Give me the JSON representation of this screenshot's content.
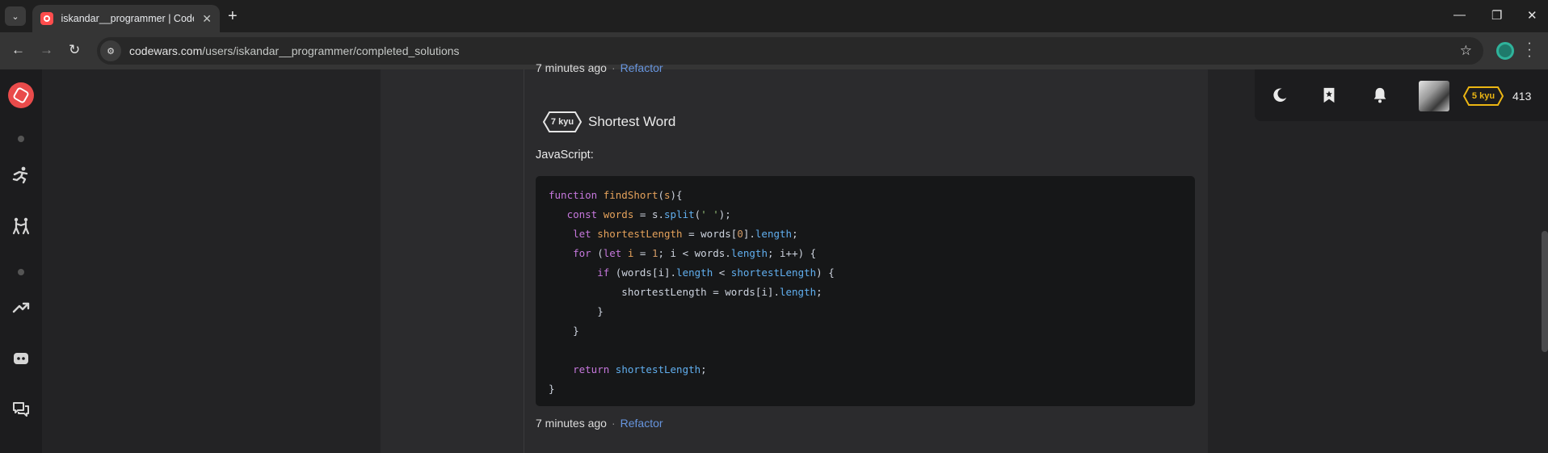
{
  "browser": {
    "tab_title": "iskandar__programmer | Codewars",
    "url_host": "codewars.com",
    "url_path": "/users/iskandar__programmer/completed_solutions",
    "new_tab": "+",
    "tab_close": "✕",
    "minimize": "—",
    "restore": "❐",
    "close": "✕",
    "back": "←",
    "forward": "→",
    "reload": "↻",
    "star": "☆",
    "site_info": "⚙",
    "tab_search": "⌄"
  },
  "topbar": {
    "kyu_badge": "5 kyu",
    "honor": "413"
  },
  "previous_solution": {
    "time": "7 minutes ago",
    "separator": "·",
    "refactor": "Refactor"
  },
  "solution": {
    "rank": "7 kyu",
    "title": "Shortest Word",
    "language": "JavaScript:",
    "time": "7 minutes ago",
    "separator": "·",
    "refactor": "Refactor",
    "code": [
      [
        {
          "t": "function ",
          "c": "kw"
        },
        {
          "t": "findShort",
          "c": "fn"
        },
        {
          "t": "(",
          "c": "light"
        },
        {
          "t": "s",
          "c": "var"
        },
        {
          "t": "){",
          "c": "light"
        }
      ],
      [
        {
          "t": "   const ",
          "c": "kw"
        },
        {
          "t": "words",
          "c": "var"
        },
        {
          "t": " = s.",
          "c": "light"
        },
        {
          "t": "split",
          "c": "prop"
        },
        {
          "t": "(",
          "c": "light"
        },
        {
          "t": "' '",
          "c": "str"
        },
        {
          "t": ");",
          "c": "light"
        }
      ],
      [
        {
          "t": "    let ",
          "c": "kw"
        },
        {
          "t": "shortestLength",
          "c": "var"
        },
        {
          "t": " = words[",
          "c": "light"
        },
        {
          "t": "0",
          "c": "num"
        },
        {
          "t": "].",
          "c": "light"
        },
        {
          "t": "length",
          "c": "prop"
        },
        {
          "t": ";",
          "c": "light"
        }
      ],
      [
        {
          "t": "    for ",
          "c": "kw"
        },
        {
          "t": "(",
          "c": "light"
        },
        {
          "t": "let ",
          "c": "kw"
        },
        {
          "t": "i",
          "c": "var"
        },
        {
          "t": " = ",
          "c": "light"
        },
        {
          "t": "1",
          "c": "num"
        },
        {
          "t": "; i < words.",
          "c": "light"
        },
        {
          "t": "length",
          "c": "prop"
        },
        {
          "t": "; i++) {",
          "c": "light"
        }
      ],
      [
        {
          "t": "        if ",
          "c": "kw"
        },
        {
          "t": "(words[i].",
          "c": "light"
        },
        {
          "t": "length",
          "c": "prop"
        },
        {
          "t": " < ",
          "c": "light"
        },
        {
          "t": "shortestLength",
          "c": "prop"
        },
        {
          "t": ") {",
          "c": "light"
        }
      ],
      [
        {
          "t": "            shortestLength = words[i].",
          "c": "light"
        },
        {
          "t": "length",
          "c": "prop"
        },
        {
          "t": ";",
          "c": "light"
        }
      ],
      [
        {
          "t": "        }",
          "c": "light"
        }
      ],
      [
        {
          "t": "    }",
          "c": "light"
        }
      ],
      [
        {
          "t": "",
          "c": "light"
        }
      ],
      [
        {
          "t": "    return ",
          "c": "kw"
        },
        {
          "t": "shortestLength",
          "c": "prop"
        },
        {
          "t": ";",
          "c": "light"
        }
      ],
      [
        {
          "t": "}",
          "c": "light"
        }
      ]
    ]
  },
  "icons": {
    "sidebar": [
      "practice-icon",
      "kumite-icon",
      "trending-icon",
      "discord-icon",
      "discussion-icon"
    ],
    "topbar": [
      "moon-icon",
      "bookmark-icon",
      "bell-icon"
    ]
  },
  "colors": {
    "accent_red": "#e94b4b",
    "link_blue": "#6795de",
    "kyu_yellow": "#ecb613"
  }
}
